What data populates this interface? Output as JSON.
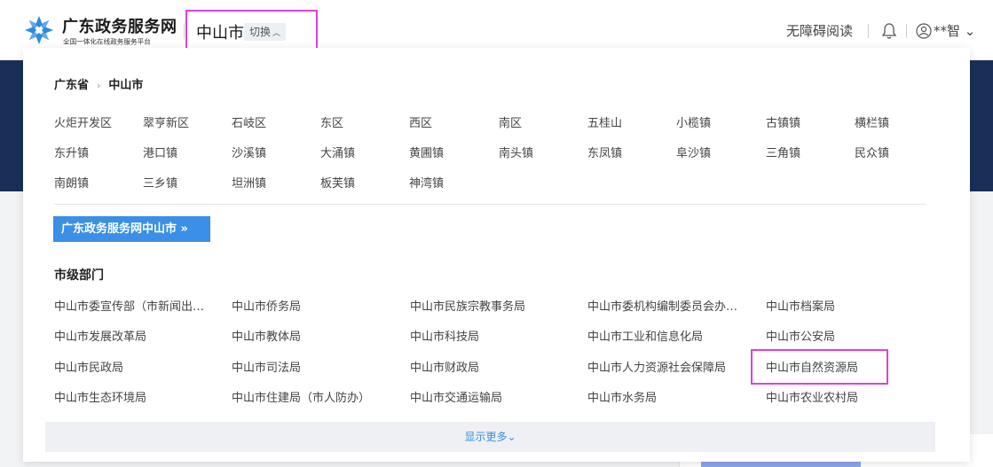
{
  "header": {
    "brand_title": "广东政务服务网",
    "brand_subtitle": "全国一体化在线政务服务平台",
    "city": "中山市",
    "switch_label": "切换",
    "accessibility_label": "无障碍阅读",
    "user_name": "**智",
    "user_caret": "⌄"
  },
  "panel": {
    "breadcrumb": {
      "province": "广东省",
      "city": "中山市",
      "separator": "›"
    },
    "areas": [
      [
        "火炬开发区",
        "翠亨新区",
        "石岐区",
        "东区",
        "西区",
        "南区",
        "五桂山",
        "小榄镇",
        "古镇镇",
        "横栏镇"
      ],
      [
        "东升镇",
        "港口镇",
        "沙溪镇",
        "大涌镇",
        "黄圃镇",
        "南头镇",
        "东凤镇",
        "阜沙镇",
        "三角镇",
        "民众镇"
      ],
      [
        "南朗镇",
        "三乡镇",
        "坦洲镇",
        "板芙镇",
        "神湾镇"
      ]
    ],
    "portal_button": "广东政务服务网中山市 »",
    "section_title": "市级部门",
    "departments": [
      [
        "中山市委宣传部（市新闻出版局）",
        "中山市侨务局",
        "中山市民族宗教事务局",
        "中山市委机构编制委员会办公室",
        "中山市档案局"
      ],
      [
        "中山市发展改革局",
        "中山市教体局",
        "中山市科技局",
        "中山市工业和信息化局",
        "中山市公安局"
      ],
      [
        "中山市民政局",
        "中山市司法局",
        "中山市财政局",
        "中山市人力资源社会保障局",
        "中山市自然资源局"
      ],
      [
        "中山市生态环境局",
        "中山市住建局（市人防办）",
        "中山市交通运输局",
        "中山市水务局",
        "中山市农业农村局"
      ]
    ],
    "show_more": "显示更多⌄"
  },
  "colors": {
    "accent": "#3b8fe6",
    "highlight": "#e03fe0",
    "banner": "#1a2f57"
  }
}
